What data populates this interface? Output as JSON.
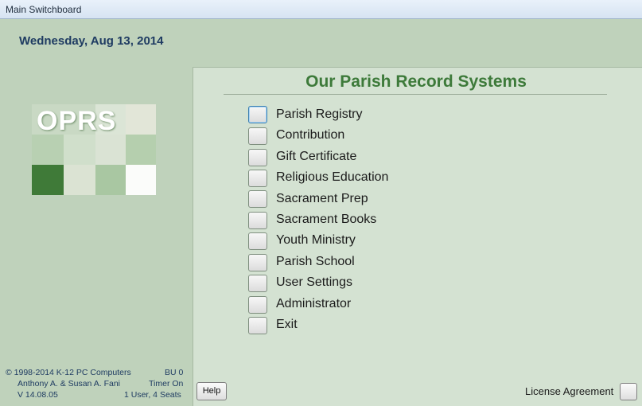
{
  "window": {
    "title": "Main Switchboard"
  },
  "header": {
    "date": "Wednesday, Aug 13, 2014"
  },
  "logo": {
    "text": "OPRS"
  },
  "panel": {
    "title": "Our Parish Record Systems"
  },
  "menu": {
    "items": [
      {
        "label": "Parish Registry"
      },
      {
        "label": "Contribution"
      },
      {
        "label": "Gift Certificate"
      },
      {
        "label": "Religious Education"
      },
      {
        "label": "Sacrament Prep"
      },
      {
        "label": "Sacrament Books"
      },
      {
        "label": "Youth Ministry"
      },
      {
        "label": "Parish School"
      },
      {
        "label": "User Settings"
      },
      {
        "label": "Administrator"
      },
      {
        "label": "Exit"
      }
    ]
  },
  "footer": {
    "copyright": "©   1998-2014 K-12 PC Computers",
    "authors": "Anthony A. & Susan A. Fani",
    "version": "V 14.08.05",
    "bu": "BU 0",
    "timer": "Timer On",
    "seats": "1 User, 4 Seats"
  },
  "buttons": {
    "help": "Help",
    "license": "License Agreement"
  },
  "colors": {
    "title_green": "#3d7a3a",
    "text_blue": "#1f3c62",
    "panel_bg": "#d4e2d2",
    "side_bg": "#bfd2bb"
  }
}
